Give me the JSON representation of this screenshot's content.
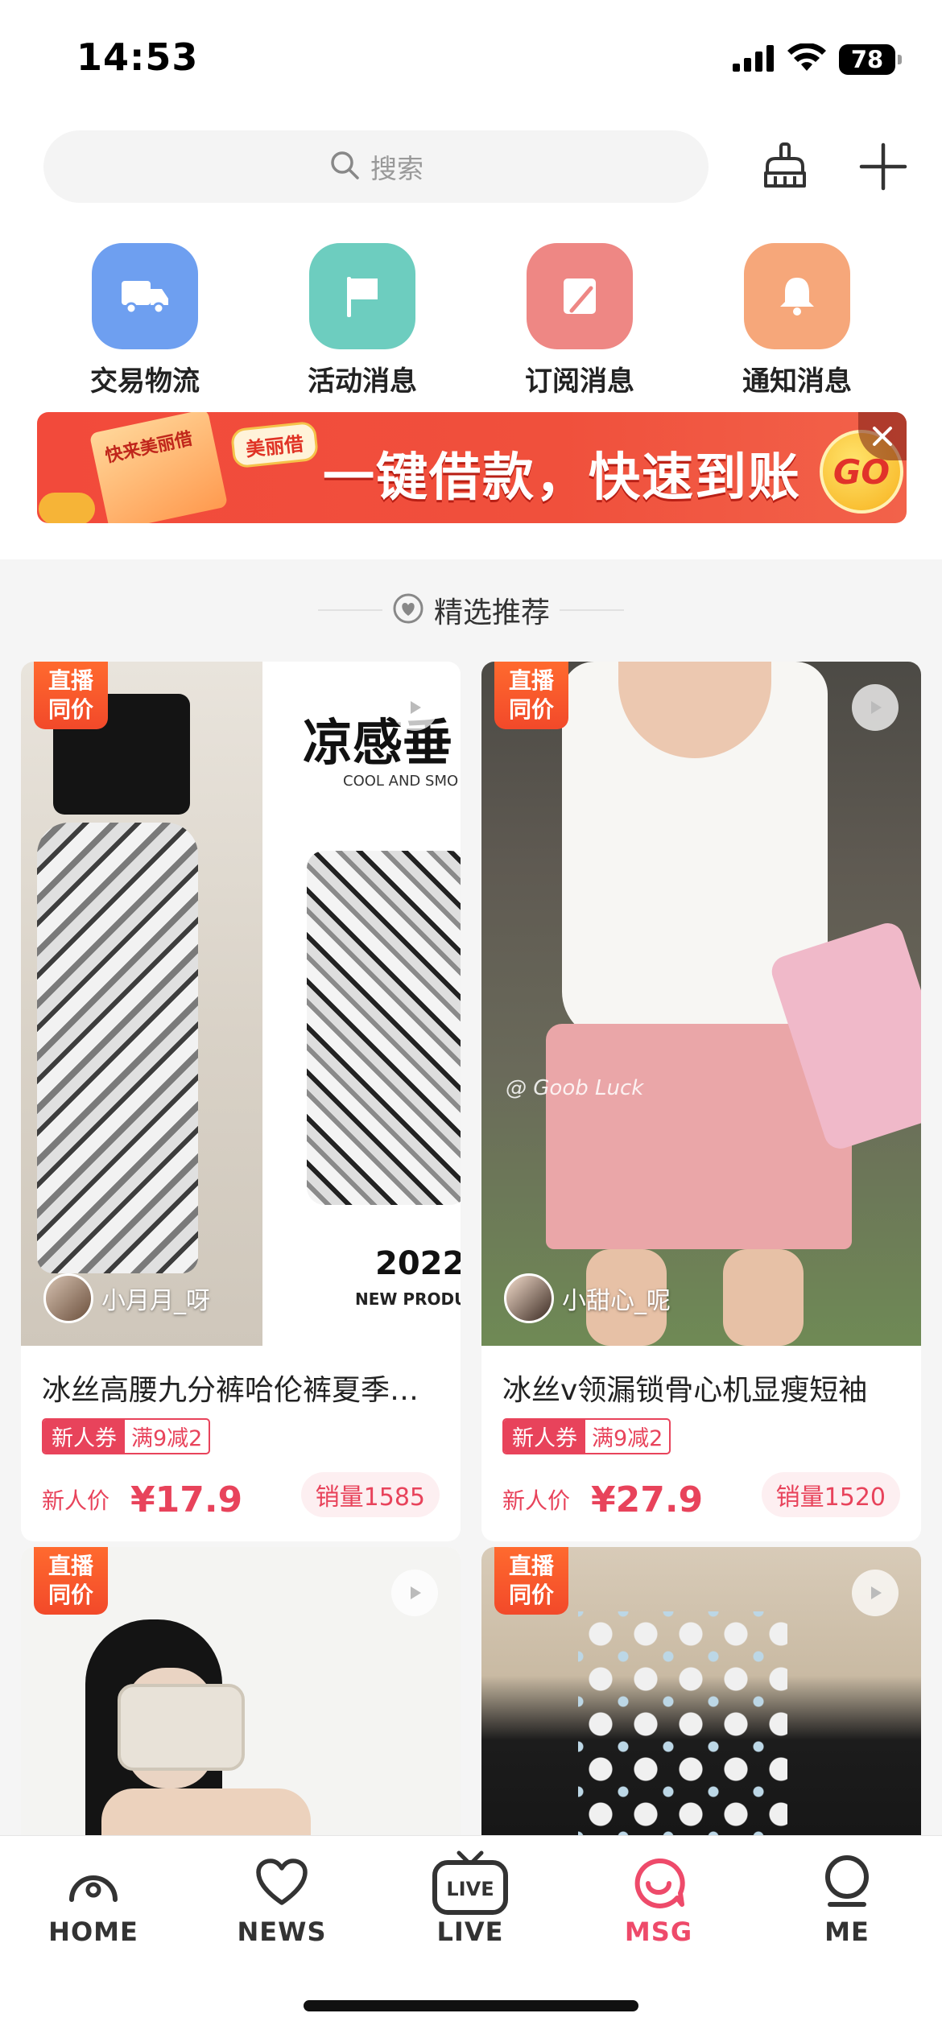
{
  "status_bar": {
    "time": "14:53",
    "battery": "78"
  },
  "search": {
    "placeholder": "搜索"
  },
  "shortcuts": [
    {
      "label": "交易物流",
      "icon": "truck-icon",
      "color": "#6e9ff0"
    },
    {
      "label": "活动消息",
      "icon": "flag-icon",
      "color": "#6dcdbf"
    },
    {
      "label": "订阅消息",
      "icon": "bookmark-icon",
      "color": "#ee8784"
    },
    {
      "label": "通知消息",
      "icon": "bell-icon",
      "color": "#f6a77a"
    }
  ],
  "banner": {
    "card_text": "快来美丽借",
    "brand": "美丽借",
    "title": "一键借款，快速到账",
    "cta": "GO"
  },
  "section_heading": "精选推荐",
  "products": [
    {
      "badge": "直播\n同价",
      "author": "小月月_呀",
      "title": "冰丝高腰九分裤哈伦裤夏季薄款",
      "coupon_left": "新人券",
      "coupon_right": "满9减2",
      "price_label": "新人价",
      "price": "¥17.9",
      "sales": "销量1585",
      "overlay_title": "凉感垂",
      "overlay_sub": "COOL AND SMO",
      "overlay_year": "2022/",
      "overlay_year_sub": "NEW PRODU"
    },
    {
      "badge": "直播\n同价",
      "author": "小甜心_呢",
      "title": "冰丝v领漏锁骨心机显瘦短袖",
      "coupon_left": "新人券",
      "coupon_right": "满9减2",
      "price_label": "新人价",
      "price": "¥27.9",
      "sales": "销量1520",
      "watermark": "@ Goob Luck"
    },
    {
      "badge": "直播\n同价"
    },
    {
      "badge": "直播\n同价"
    }
  ],
  "tabs": [
    {
      "label": "HOME",
      "icon": "home-icon",
      "active": false
    },
    {
      "label": "NEWS",
      "icon": "heart-icon",
      "active": false
    },
    {
      "label": "LIVE",
      "icon": "live-tv-icon",
      "active": false,
      "icon_text": "LIVE"
    },
    {
      "label": "MSG",
      "icon": "message-icon",
      "active": true
    },
    {
      "label": "ME",
      "icon": "profile-icon",
      "active": false
    }
  ],
  "colors": {
    "accent": "#ee4a6a",
    "price": "#e8435b",
    "live_badge": "#f2492a"
  }
}
